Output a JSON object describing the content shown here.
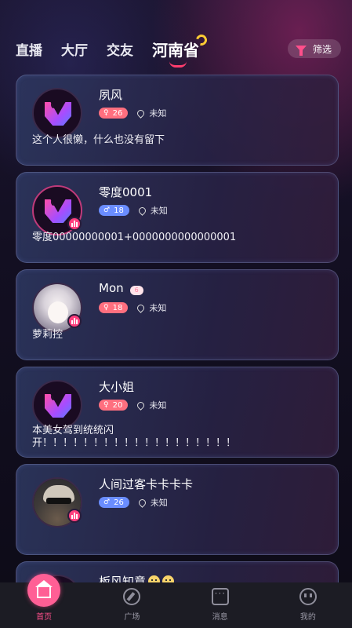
{
  "tabs": [
    {
      "label": "直播"
    },
    {
      "label": "大厅"
    },
    {
      "label": "交友"
    },
    {
      "label": "河南省",
      "active": true
    }
  ],
  "filter": {
    "label": "筛选",
    "icon": "funnel-icon"
  },
  "users": [
    {
      "name": "夙风",
      "gender": "female",
      "gender_symbol": "♀",
      "age": "26",
      "location": "未知",
      "bio": "这个人很懒，什么也没有留下",
      "avatar": "app-logo",
      "live": false
    },
    {
      "name": "零度0001",
      "gender": "male",
      "gender_symbol": "♂",
      "age": "18",
      "location": "未知",
      "bio": "零度00000000001+0000000000000001",
      "avatar": "app-logo",
      "live": true
    },
    {
      "name": "Mon",
      "gender": "female",
      "gender_symbol": "♀",
      "age": "18",
      "location": "未知",
      "bio": "萝莉控",
      "avatar": "photo-girl",
      "live": true,
      "level_badge": "6"
    },
    {
      "name": "大小姐",
      "gender": "female",
      "gender_symbol": "♀",
      "age": "20",
      "location": "未知",
      "bio": "本美女驾到统统闪开！！！！！！！！！！！！！！！！！！！",
      "avatar": "app-logo",
      "live": false
    },
    {
      "name": "人间过客卡卡卡卡",
      "gender": "male",
      "gender_symbol": "♂",
      "age": "26",
      "location": "未知",
      "bio": "",
      "avatar": "photo-man",
      "live": true
    },
    {
      "name": "板风知意",
      "partial": true
    }
  ],
  "bottom_nav": [
    {
      "label": "首页",
      "icon": "home-icon",
      "active": true
    },
    {
      "label": "广场",
      "icon": "compass-icon"
    },
    {
      "label": "消息",
      "icon": "chat-icon"
    },
    {
      "label": "我的",
      "icon": "profile-icon"
    }
  ],
  "colors": {
    "accent": "#ff4f8b",
    "female": "#ff6f7f",
    "male": "#6a8dff"
  }
}
